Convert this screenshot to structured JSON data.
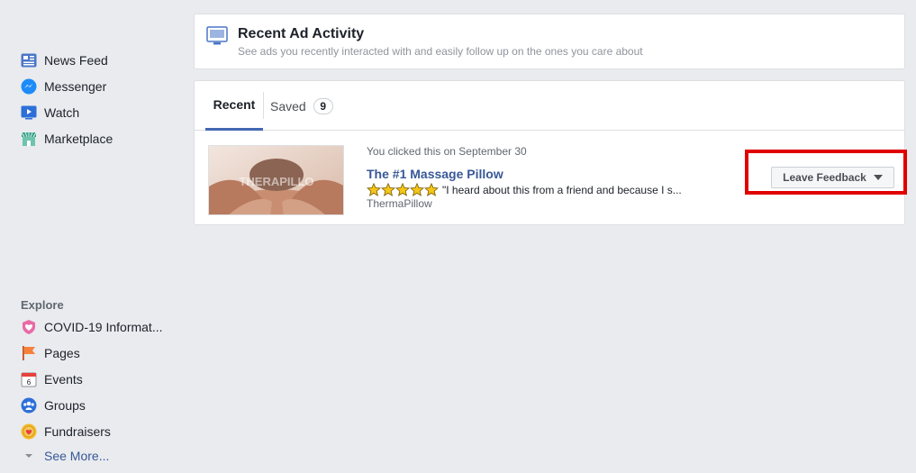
{
  "sidebar": {
    "items": [
      {
        "label": "News Feed",
        "icon": "news-feed-icon"
      },
      {
        "label": "Messenger",
        "icon": "messenger-icon"
      },
      {
        "label": "Watch",
        "icon": "watch-icon"
      },
      {
        "label": "Marketplace",
        "icon": "marketplace-icon"
      }
    ],
    "explore_title": "Explore",
    "explore_items": [
      {
        "label": "COVID-19 Informat...",
        "icon": "covid-heart-icon"
      },
      {
        "label": "Pages",
        "icon": "flag-icon"
      },
      {
        "label": "Events",
        "icon": "calendar-icon"
      },
      {
        "label": "Groups",
        "icon": "groups-icon"
      },
      {
        "label": "Fundraisers",
        "icon": "fundraiser-icon"
      }
    ],
    "see_more": "See More..."
  },
  "header": {
    "title": "Recent Ad Activity",
    "subtitle": "See ads you recently interacted with and easily follow up on the ones you care about"
  },
  "tabs": {
    "recent": "Recent",
    "saved": "Saved",
    "saved_count": "9"
  },
  "ad": {
    "meta": "You clicked this on September 30",
    "title": "The #1 Massage Pillow",
    "rating_stars": 5,
    "snippet": "\"I heard about this from a friend and because I s...",
    "brand": "ThermaPillow",
    "thumb_watermark": "THERAPILLO"
  },
  "feedback": {
    "label": "Leave Feedback"
  },
  "colors": {
    "link": "#385898",
    "tab_active": "#4267b2",
    "highlight": "#e00000",
    "background": "#e9ebee"
  }
}
